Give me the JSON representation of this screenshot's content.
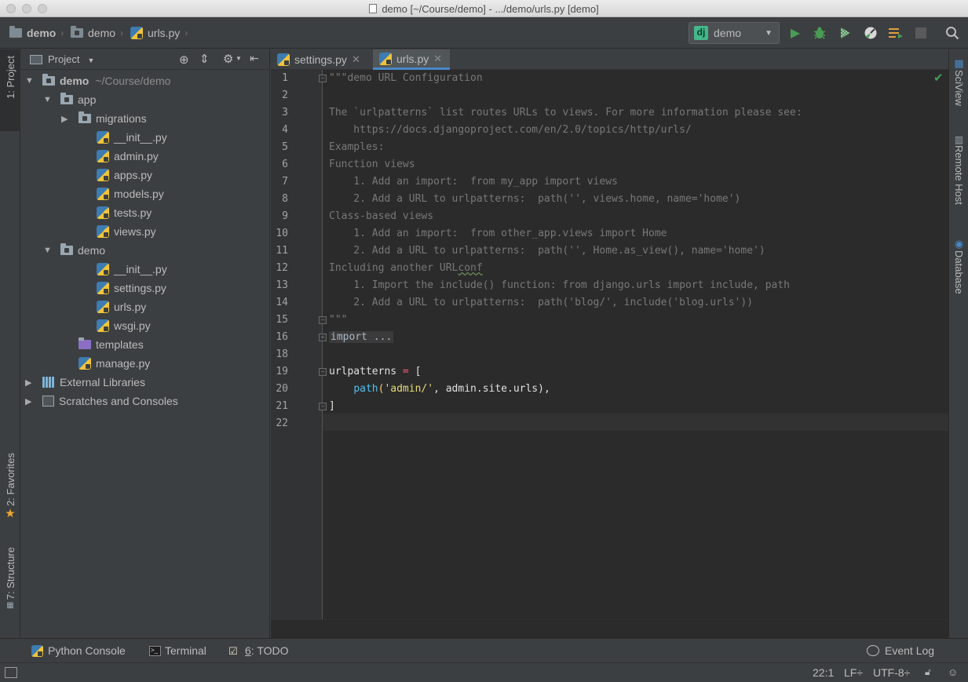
{
  "window": {
    "title": "demo [~/Course/demo] - .../demo/urls.py [demo]"
  },
  "navbar": {
    "crumbs": [
      "demo",
      "demo",
      "urls.py"
    ],
    "run_config": "dj",
    "run_config_name": "demo"
  },
  "left_stripe": {
    "project_tab": "1: Project",
    "favorites_tab": "2: Favorites",
    "structure_tab": "7: Structure"
  },
  "project": {
    "header": "Project",
    "tree": [
      {
        "label": "demo",
        "hint": "~/Course/demo",
        "indent": 0,
        "arrow": "down",
        "icon": "folder-module"
      },
      {
        "label": "app",
        "indent": 1,
        "arrow": "down",
        "icon": "folder-package"
      },
      {
        "label": "migrations",
        "indent": 2,
        "arrow": "right",
        "icon": "folder-package"
      },
      {
        "label": "__init__.py",
        "indent": 3,
        "arrow": "",
        "icon": "python"
      },
      {
        "label": "admin.py",
        "indent": 3,
        "arrow": "",
        "icon": "python"
      },
      {
        "label": "apps.py",
        "indent": 3,
        "arrow": "",
        "icon": "python"
      },
      {
        "label": "models.py",
        "indent": 3,
        "arrow": "",
        "icon": "python"
      },
      {
        "label": "tests.py",
        "indent": 3,
        "arrow": "",
        "icon": "python"
      },
      {
        "label": "views.py",
        "indent": 3,
        "arrow": "",
        "icon": "python"
      },
      {
        "label": "demo",
        "indent": 1,
        "arrow": "down",
        "icon": "folder-package"
      },
      {
        "label": "__init__.py",
        "indent": 3,
        "arrow": "",
        "icon": "python"
      },
      {
        "label": "settings.py",
        "indent": 3,
        "arrow": "",
        "icon": "python"
      },
      {
        "label": "urls.py",
        "indent": 3,
        "arrow": "",
        "icon": "python"
      },
      {
        "label": "wsgi.py",
        "indent": 3,
        "arrow": "",
        "icon": "python"
      },
      {
        "label": "templates",
        "indent": 2,
        "arrow": "",
        "icon": "folder-templates"
      },
      {
        "label": "manage.py",
        "indent": 2,
        "arrow": "",
        "icon": "python"
      },
      {
        "label": "External Libraries",
        "indent": 0,
        "arrow": "right",
        "icon": "libraries"
      },
      {
        "label": "Scratches and Consoles",
        "indent": 0,
        "arrow": "right",
        "icon": "scratches"
      }
    ]
  },
  "tabs": [
    {
      "label": "settings.py",
      "active": false
    },
    {
      "label": "urls.py",
      "active": true
    }
  ],
  "editor": {
    "line_numbers": [
      "1",
      "2",
      "3",
      "4",
      "5",
      "6",
      "7",
      "8",
      "9",
      "10",
      "11",
      "12",
      "13",
      "14",
      "15",
      "16",
      "18",
      "19",
      "20",
      "21",
      "22"
    ],
    "lines": [
      "\"\"\"demo URL Configuration",
      "",
      "The `urlpatterns` list routes URLs to views. For more information please see:",
      "    https://docs.djangoproject.com/en/2.0/topics/http/urls/",
      "Examples:",
      "Function views",
      "    1. Add an import:  from my_app import views",
      "    2. Add a URL to urlpatterns:  path('', views.home, name='home')",
      "Class-based views",
      "    1. Add an import:  from other_app.views import Home",
      "    2. Add a URL to urlpatterns:  path('', Home.as_view(), name='home')",
      "Including another URLconf",
      "    1. Import the include() function: from django.urls import include, path",
      "    2. Add a URL to urlpatterns:  path('blog/', include('blog.urls'))",
      "\"\"\"",
      "import ...",
      "",
      "urlpatterns = [",
      "    path('admin/', admin.site.urls),",
      "]",
      ""
    ],
    "l19": {
      "name": "urlpatterns",
      "eq": " = ",
      "bracket": "["
    },
    "l20": {
      "indent": "    ",
      "fn": "path",
      "open": "(",
      "str": "'admin/'",
      "rest": ", admin.site.urls),"
    }
  },
  "right_stripe": {
    "sciview": "SciView",
    "remote": "Remote Host",
    "database": "Database"
  },
  "bottom": {
    "python_console": "Python Console",
    "terminal": "Terminal",
    "todo_num": "6",
    "todo": ": TODO",
    "event_log": "Event Log"
  },
  "status": {
    "position": "22:1",
    "line_sep": "LF÷",
    "encoding": "UTF-8÷"
  },
  "colors": {
    "docstring": "#787878",
    "accent": "#4a88c7",
    "run_green": "#499c54"
  }
}
